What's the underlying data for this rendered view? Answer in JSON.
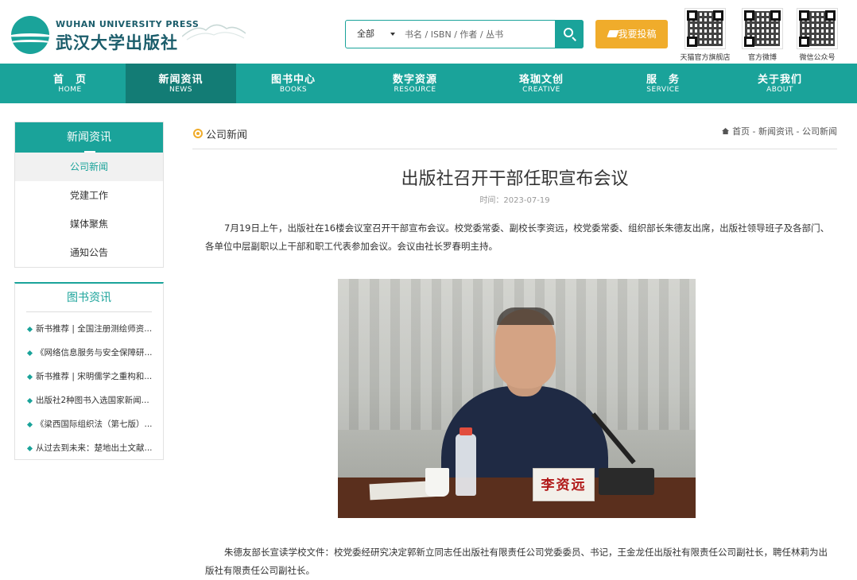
{
  "header": {
    "logo_en": "WUHAN UNIVERSITY PRESS",
    "logo_cn": "武汉大学出版社",
    "search": {
      "scope": "全部",
      "placeholder": "书名 / ISBN / 作者 / 丛书"
    },
    "submit_label": "我要投稿",
    "qr_codes": [
      {
        "label": "天猫官方旗舰店"
      },
      {
        "label": "官方微博"
      },
      {
        "label": "微信公众号"
      }
    ]
  },
  "nav": [
    {
      "cn": "首　页",
      "en": "HOME"
    },
    {
      "cn": "新闻资讯",
      "en": "NEWS"
    },
    {
      "cn": "图书中心",
      "en": "BOOKS"
    },
    {
      "cn": "数字资源",
      "en": "RESOURCE"
    },
    {
      "cn": "珞珈文创",
      "en": "CREATIVE"
    },
    {
      "cn": "服　务",
      "en": "SERVICE"
    },
    {
      "cn": "关于我们",
      "en": "ABOUT"
    }
  ],
  "nav_active_index": 1,
  "sidebar": {
    "title": "新闻资讯",
    "items": [
      "公司新闻",
      "党建工作",
      "媒体聚焦",
      "通知公告"
    ],
    "active_index": 0
  },
  "book_news": {
    "title": "图书资讯",
    "items": [
      "新书推荐 | 全国注册测绘师资...",
      "《网络信息服务与安全保障研...",
      "新书推荐 | 宋明儒学之重构和...",
      "出版社2种图书入选国家新闻...",
      "《梁西国际组织法（第七版）...",
      "从过去到未来：楚地出土文献..."
    ]
  },
  "main": {
    "section_title": "公司新闻",
    "breadcrumb": [
      "首页",
      "新闻资讯",
      "公司新闻"
    ],
    "breadcrumb_sep": " - ",
    "article_title": "出版社召开干部任职宣布会议",
    "date": "时间：2023-07-19",
    "paragraphs": [
      "7月19日上午，出版社在16楼会议室召开干部宣布会议。校党委常委、副校长李资远，校党委常委、组织部长朱德友出席，出版社领导班子及各部门、各单位中层副职以上干部和职工代表参加会议。会议由社长罗春明主持。",
      "朱德友部长宣读学校文件：校党委经研究决定郭新立同志任出版社有限责任公司党委委员、书记，王金龙任出版社有限责任公司副社长，聘任林莉为出版社有限责任公司副社长。"
    ],
    "photo_nameplate": "李资远"
  }
}
